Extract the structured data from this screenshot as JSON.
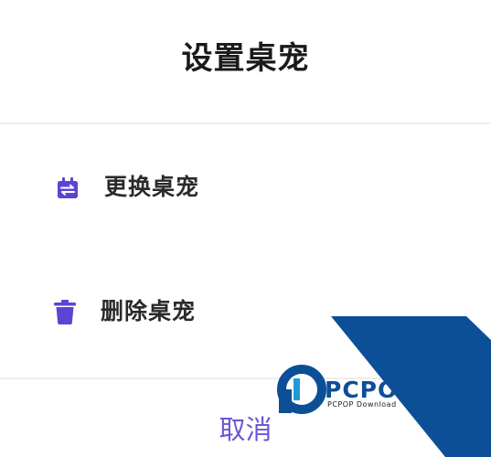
{
  "dialog": {
    "title": "设置桌宠",
    "accent_color": "#5a46d2",
    "items": [
      {
        "label": "更换桌宠",
        "icon": "calendar-swap-icon"
      },
      {
        "label": "删除桌宠",
        "icon": "trash-icon"
      }
    ],
    "cancel_label": "取消"
  },
  "watermark": {
    "brand": "PCPOP下载",
    "sub": "PCPOP Download",
    "color": "#0d4f96"
  }
}
